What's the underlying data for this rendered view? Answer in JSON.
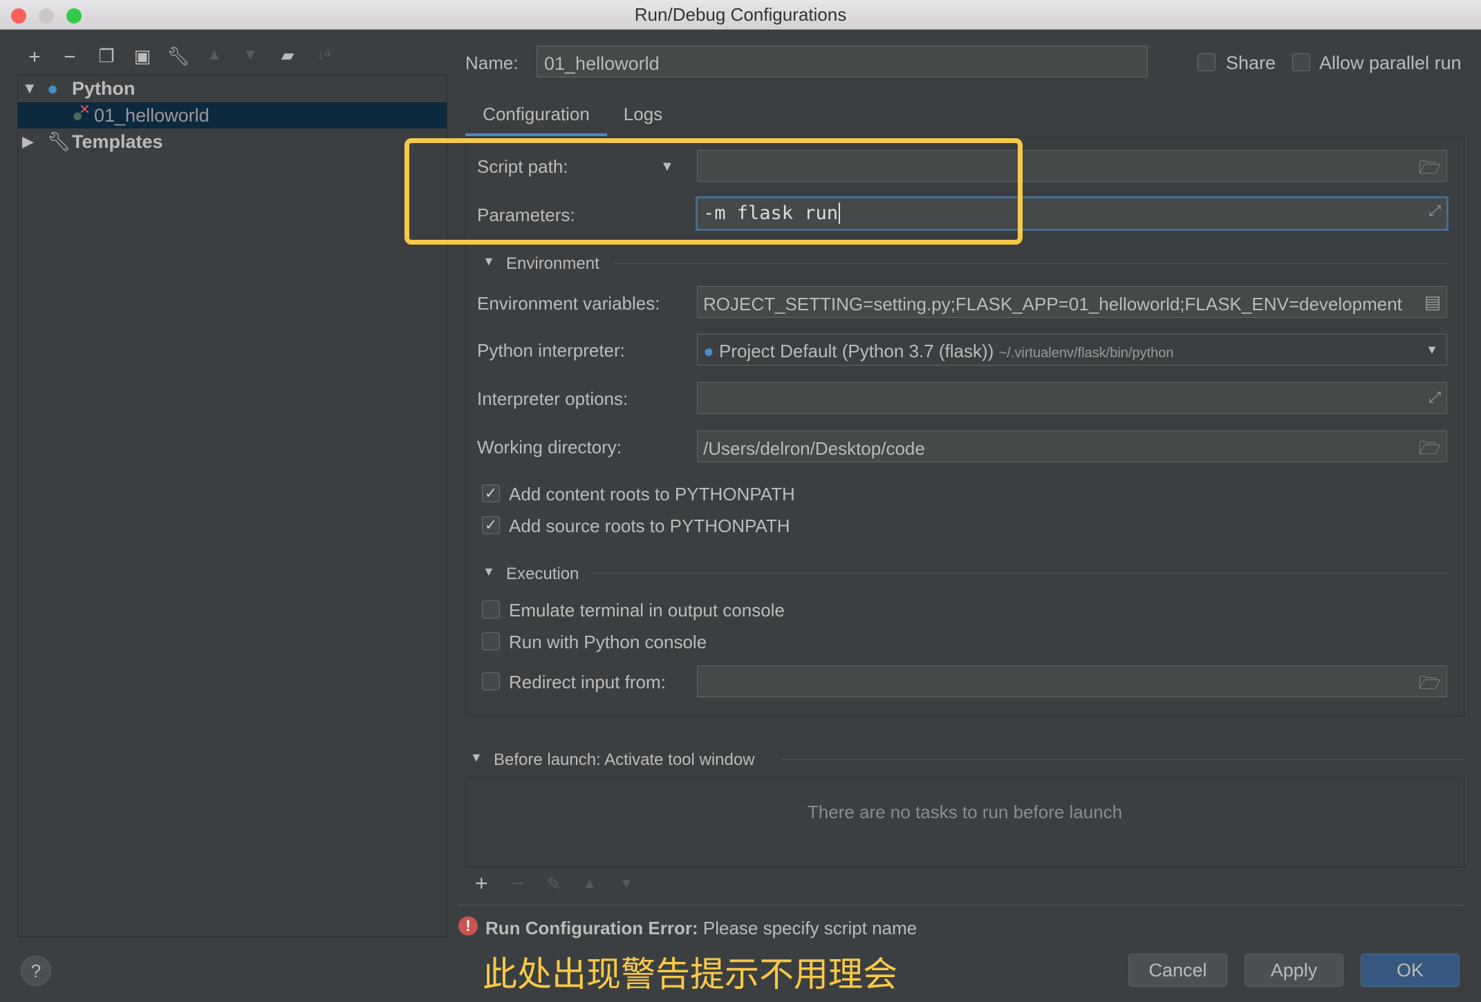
{
  "window": {
    "title": "Run/Debug Configurations"
  },
  "toolbar": {
    "icons": [
      "add-icon",
      "remove-icon",
      "copy-icon",
      "save-icon",
      "wrench-icon",
      "move-up-icon",
      "move-down-icon",
      "new-folder-icon",
      "sort-icon"
    ]
  },
  "tree": {
    "python": "Python",
    "config": "01_helloworld",
    "templates": "Templates"
  },
  "name": {
    "label": "Name:",
    "value": "01_helloworld"
  },
  "share": {
    "label": "Share",
    "checked": false
  },
  "parallel": {
    "label": "Allow parallel run",
    "checked": false
  },
  "tabs": [
    {
      "label": "Configuration",
      "active": true
    },
    {
      "label": "Logs",
      "active": false
    }
  ],
  "form": {
    "script_path": {
      "label": "Script path:",
      "value": ""
    },
    "parameters": {
      "label": "Parameters:",
      "value": "-m flask run"
    },
    "environment": "Environment",
    "env_vars": {
      "label": "Environment variables:",
      "value": "ROJECT_SETTING=setting.py;FLASK_APP=01_helloworld;FLASK_ENV=development"
    },
    "interpreter": {
      "label": "Python interpreter:",
      "value": "Project Default (Python 3.7 (flask))",
      "path": "~/.virtualenv/flask/bin/python"
    },
    "interp_options": {
      "label": "Interpreter options:",
      "value": ""
    },
    "working_dir": {
      "label": "Working directory:",
      "value": "/Users/delron/Desktop/code"
    },
    "content_roots": {
      "label": "Add content roots to PYTHONPATH",
      "checked": true
    },
    "source_roots": {
      "label": "Add source roots to PYTHONPATH",
      "checked": true
    },
    "execution": "Execution",
    "emulate": {
      "label": "Emulate terminal in output console",
      "checked": false
    },
    "python_console": {
      "label": "Run with Python console",
      "checked": false
    },
    "redirect": {
      "label": "Redirect input from:",
      "checked": false,
      "value": ""
    }
  },
  "before_launch": {
    "header": "Before launch: Activate tool window",
    "empty": "There are no tasks to run before launch"
  },
  "error": {
    "bold": "Run Configuration Error:",
    "text": "Please specify script name"
  },
  "annotation": "此处出现警告提示不用理会",
  "buttons": {
    "cancel": "Cancel",
    "apply": "Apply",
    "ok": "OK",
    "help": "?"
  },
  "colors": {
    "highlight": "#f7c948",
    "accent": "#365880",
    "selection": "#0d293e",
    "error": "#c75450"
  }
}
